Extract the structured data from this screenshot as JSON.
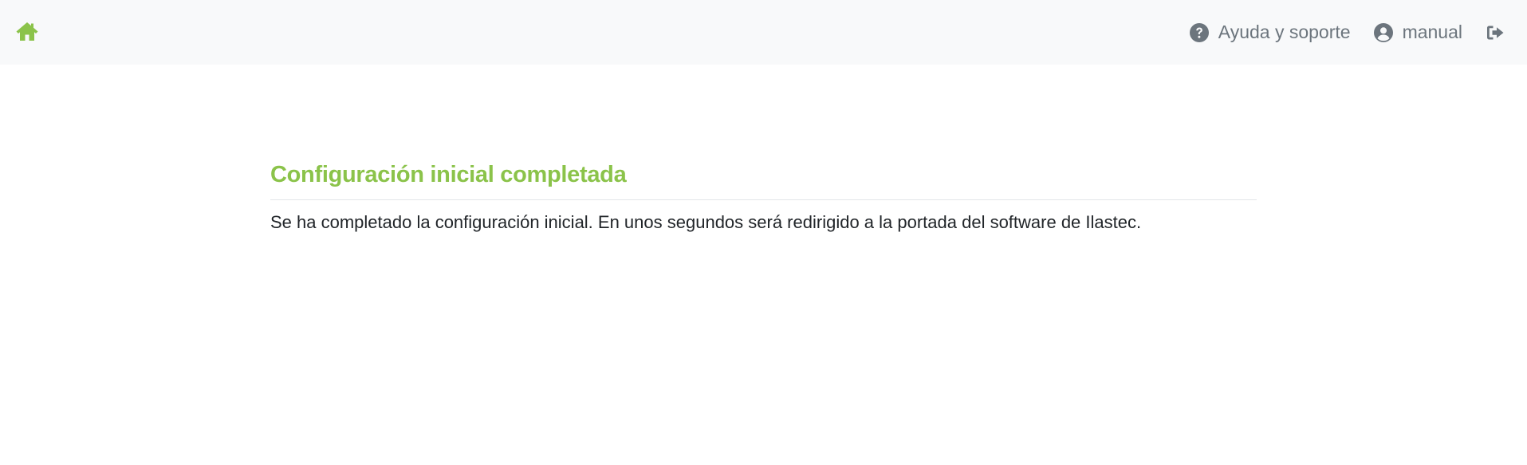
{
  "navbar": {
    "home_icon": "home-icon",
    "help": {
      "icon": "question-circle-icon",
      "label": "Ayuda y soporte"
    },
    "user": {
      "icon": "user-circle-icon",
      "label": "manual"
    },
    "logout": {
      "icon": "sign-out-icon"
    }
  },
  "main": {
    "title": "Configuración inicial completada",
    "message": "Se ha completado la configuración inicial. En unos segundos será redirigido a la portada del software de Ilastec."
  },
  "colors": {
    "accent": "#8bc34a",
    "navbar_bg": "#f8f9fa",
    "nav_text": "#6c757d",
    "body_text": "#212529"
  }
}
